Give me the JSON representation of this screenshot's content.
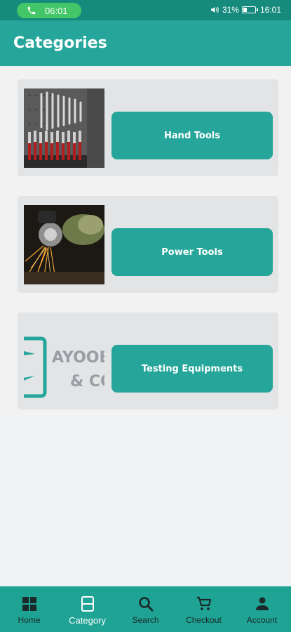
{
  "status_bar": {
    "call_time": "06:01",
    "battery": "31%",
    "clock": "16:01"
  },
  "app_bar": {
    "title": "Categories"
  },
  "categories": [
    {
      "label": "Hand Tools",
      "image": "hand-tools-photo"
    },
    {
      "label": "Power Tools",
      "image": "power-tools-photo"
    },
    {
      "label": "Testing Equipments",
      "image": "ayoob-logo",
      "logo_text": [
        "AYOOB",
        "& CO"
      ]
    }
  ],
  "bottom_nav": [
    {
      "label": "Home",
      "icon": "home-grid-icon",
      "active": false
    },
    {
      "label": "Category",
      "icon": "category-icon",
      "active": true
    },
    {
      "label": "Search",
      "icon": "search-icon",
      "active": false
    },
    {
      "label": "Checkout",
      "icon": "cart-icon",
      "active": false
    },
    {
      "label": "Account",
      "icon": "account-icon",
      "active": false
    }
  ],
  "colors": {
    "primary": "#26a69a",
    "status_bar": "#168a7d",
    "call_pill": "#43c667",
    "card_bg": "#e3e4e6"
  }
}
